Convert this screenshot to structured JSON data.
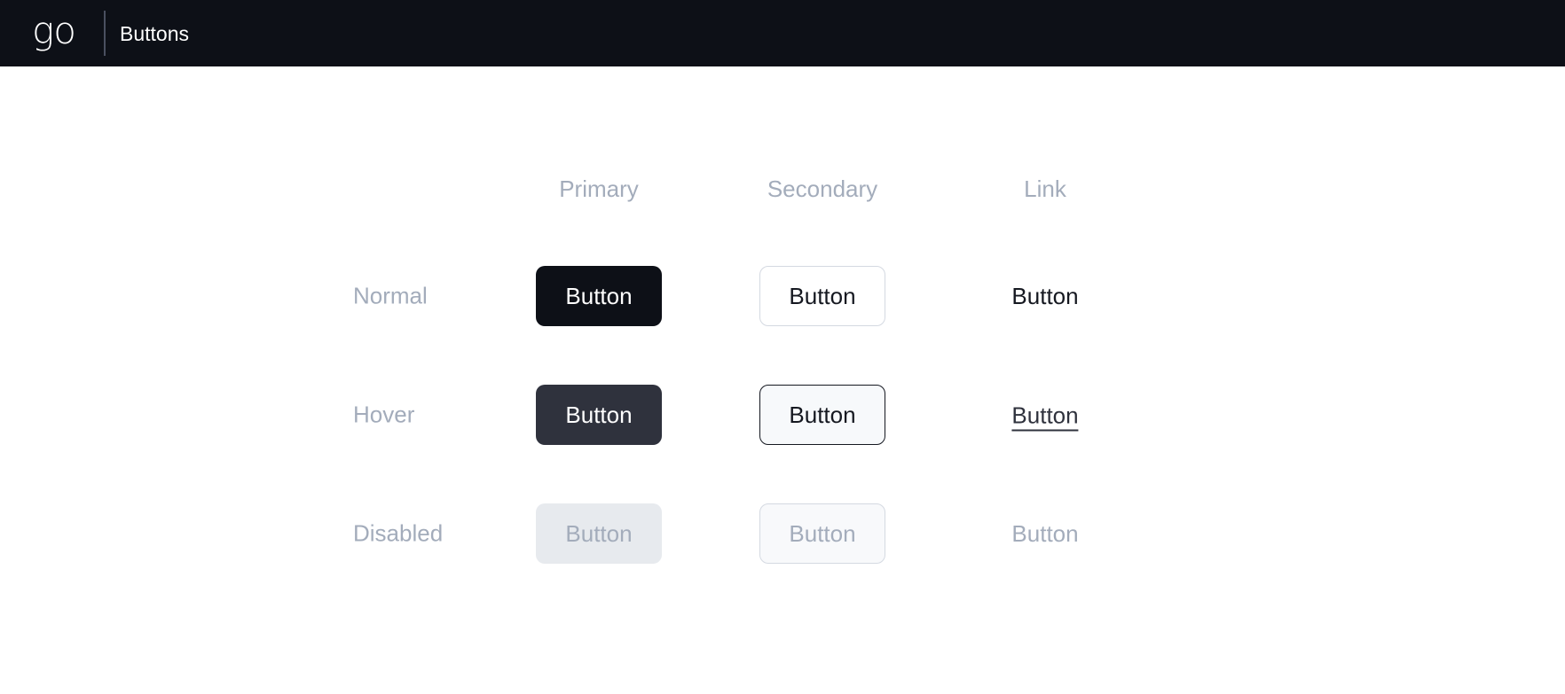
{
  "topbar": {
    "logo": "go",
    "title": "Buttons"
  },
  "columns": [
    "Primary",
    "Secondary",
    "Link"
  ],
  "rows": [
    "Normal",
    "Hover",
    "Disabled"
  ],
  "buttons": {
    "primary": {
      "normal": "Button",
      "hover": "Button",
      "disabled": "Button"
    },
    "secondary": {
      "normal": "Button",
      "hover": "Button",
      "disabled": "Button"
    },
    "link": {
      "normal": "Button",
      "hover": "Button",
      "disabled": "Button"
    }
  },
  "colors": {
    "topbar_bg": "#0d1017",
    "primary_normal": "#0d1017",
    "primary_hover": "#2f323d",
    "primary_disabled": "#e7eaee",
    "muted_text": "#a3acbb",
    "border": "#d4d9e1"
  }
}
